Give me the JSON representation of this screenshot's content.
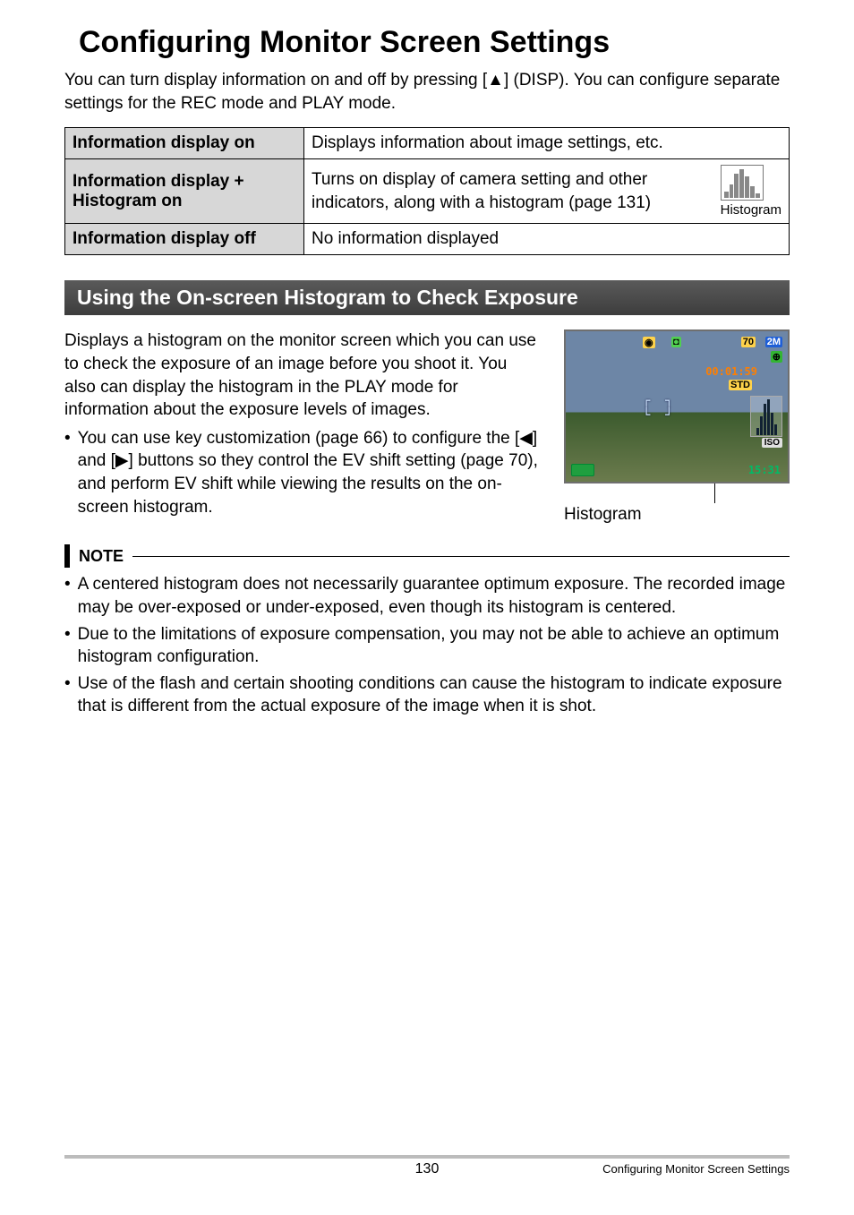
{
  "title": "Configuring Monitor Screen Settings",
  "intro_part1": "You can turn display information on and off by pressing [",
  "intro_up": "▲",
  "intro_part2": "] (DISP). You can configure separate settings for the REC mode and PLAY mode.",
  "table": {
    "r1h": "Information display on",
    "r1d": "Displays information about image settings, etc.",
    "r2h": "Information display + Histogram on",
    "r2d": "Turns on display of camera setting and other indicators, along with a histogram (page 131)",
    "r2thumb": "Histogram",
    "r3h": "Information display off",
    "r3d": "No information displayed"
  },
  "section_bar": "Using the On-screen Histogram to Check Exposure",
  "histo_para": "Displays a histogram on the monitor screen which you can use to check the exposure of an image before you shoot it. You also can display the histogram in the PLAY mode for information about the exposure levels of images.",
  "histo_bullet_pre": "You can use key customization (page 66) to configure the [",
  "histo_left": "◀",
  "histo_mid": "] and [",
  "histo_right": "▶",
  "histo_bullet_post": "] buttons so they control the EV shift setting (page 70), and perform EV shift while viewing the results on the on-screen histogram.",
  "screenshot": {
    "count": "70",
    "size": "2M",
    "time": "00:01:59",
    "std": "STD",
    "iso": "ISO",
    "clock": "15:31",
    "brackets": "┌  ┐\n└  ┘"
  },
  "histo_caption": "Histogram",
  "note_label": "NOTE",
  "notes": [
    "A centered histogram does not necessarily guarantee optimum exposure. The recorded image may be over-exposed or under-exposed, even though its histogram is centered.",
    "Due to the limitations of exposure compensation, you may not be able to achieve an optimum histogram configuration.",
    "Use of the flash and certain shooting conditions can cause the histogram to indicate exposure that is different from the actual exposure of the image when it is shot."
  ],
  "footer": {
    "page": "130",
    "section": "Configuring Monitor Screen Settings"
  },
  "bullet_char": "•"
}
